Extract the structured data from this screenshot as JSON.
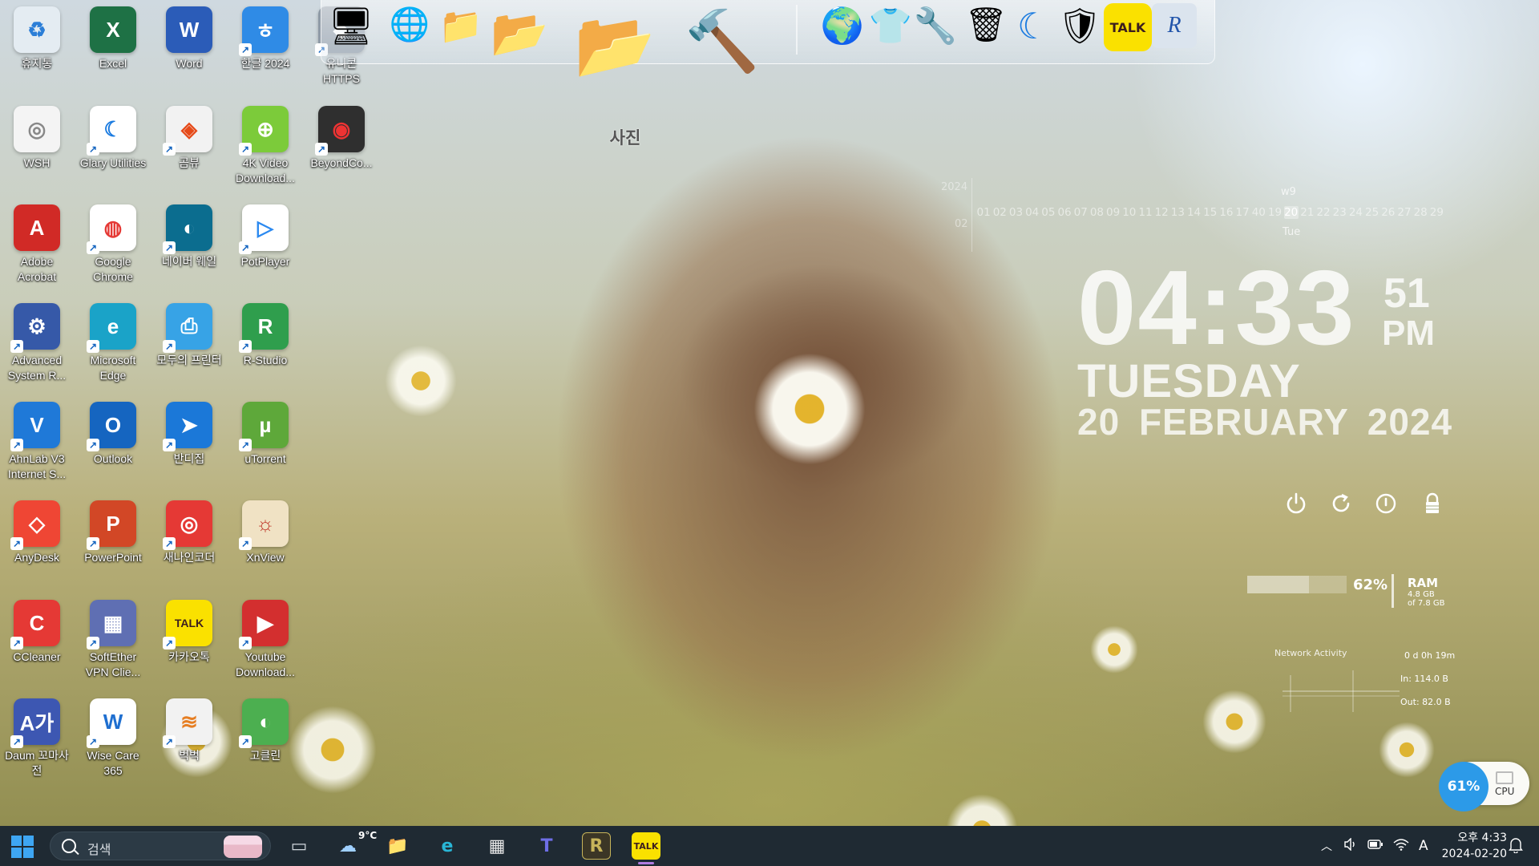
{
  "desktop": {
    "icons": [
      {
        "label": "휴지통",
        "color": "#e4ecf2",
        "fg": "#2b7ed7",
        "glyph": "♻",
        "shortcut": false
      },
      {
        "label": "Excel",
        "color": "#1e7145",
        "fg": "#fff",
        "glyph": "X",
        "shortcut": false
      },
      {
        "label": "Word",
        "color": "#2b5cb8",
        "fg": "#fff",
        "glyph": "W",
        "shortcut": false
      },
      {
        "label": "한글 2024",
        "color": "#2f8be6",
        "fg": "#fff",
        "glyph": "ㅎ",
        "shortcut": true
      },
      {
        "label": "유니콘 HTTPS",
        "color": "#8f9aa6",
        "fg": "#fff",
        "glyph": "◆",
        "shortcut": true
      },
      {
        "label": "WSH",
        "color": "#f4f4f4",
        "fg": "#888",
        "glyph": "◎",
        "shortcut": false
      },
      {
        "label": "Glary Utilities",
        "color": "#ffffff",
        "fg": "#1b7be0",
        "glyph": "☾",
        "shortcut": true
      },
      {
        "label": "곰뷰",
        "color": "#f2f2f2",
        "fg": "#e64a19",
        "glyph": "◈",
        "shortcut": true
      },
      {
        "label": "4K Video Download...",
        "color": "#7ccb3a",
        "fg": "#fff",
        "glyph": "⊕",
        "shortcut": true
      },
      {
        "label": "BeyondCo...",
        "color": "#2f2f2f",
        "fg": "#e33",
        "glyph": "◉",
        "shortcut": true
      },
      {
        "label": "Adobe Acrobat",
        "color": "#d12a26",
        "fg": "#fff",
        "glyph": "A",
        "shortcut": false
      },
      {
        "label": "Google Chrome",
        "color": "#ffffff",
        "fg": "#e53935",
        "glyph": "◍",
        "shortcut": true
      },
      {
        "label": "네이버 웨일",
        "color": "#0b6d8f",
        "fg": "#fff",
        "glyph": "◐",
        "shortcut": true
      },
      {
        "label": "PotPlayer",
        "color": "#ffffff",
        "fg": "#2b89f0",
        "glyph": "▷",
        "shortcut": true
      },
      {
        "label": "Advanced System R...",
        "color": "#3659a8",
        "fg": "#fff",
        "glyph": "⚙",
        "shortcut": true
      },
      {
        "label": "Microsoft Edge",
        "color": "#1aa3c8",
        "fg": "#fff",
        "glyph": "e",
        "shortcut": true
      },
      {
        "label": "모두의 프린터",
        "color": "#37a3e6",
        "fg": "#fff",
        "glyph": "⎙",
        "shortcut": true
      },
      {
        "label": "R-Studio",
        "color": "#2f9e4d",
        "fg": "#fff",
        "glyph": "R",
        "shortcut": true
      },
      {
        "label": "AhnLab V3 Internet S...",
        "color": "#1f79d8",
        "fg": "#fff",
        "glyph": "V",
        "shortcut": true
      },
      {
        "label": "Outlook",
        "color": "#1565c0",
        "fg": "#fff",
        "glyph": "O",
        "shortcut": true
      },
      {
        "label": "반디집",
        "color": "#1b78d8",
        "fg": "#fff",
        "glyph": "➤",
        "shortcut": true
      },
      {
        "label": "uTorrent",
        "color": "#5ea83a",
        "fg": "#fff",
        "glyph": "µ",
        "shortcut": true
      },
      {
        "label": "AnyDesk",
        "color": "#ef4634",
        "fg": "#fff",
        "glyph": "◇",
        "shortcut": true
      },
      {
        "label": "PowerPoint",
        "color": "#d24726",
        "fg": "#fff",
        "glyph": "P",
        "shortcut": true
      },
      {
        "label": "새나인코더",
        "color": "#e53935",
        "fg": "#fff",
        "glyph": "◎",
        "shortcut": true
      },
      {
        "label": "XnView",
        "color": "#f0e2c4",
        "fg": "#c0392b",
        "glyph": "☼",
        "shortcut": true
      },
      {
        "label": "CCleaner",
        "color": "#e53935",
        "fg": "#fff",
        "glyph": "C",
        "shortcut": true
      },
      {
        "label": "SoftEther VPN Clie...",
        "color": "#5f6fb3",
        "fg": "#fff",
        "glyph": "▦",
        "shortcut": true
      },
      {
        "label": "카카오톡",
        "color": "#fae100",
        "fg": "#3c1e1e",
        "glyph": "TALK",
        "shortcut": true
      },
      {
        "label": "Youtube Download...",
        "color": "#d32f2f",
        "fg": "#fff",
        "glyph": "▶",
        "shortcut": true
      },
      {
        "label": "Daum 꼬마사전",
        "color": "#3d57b2",
        "fg": "#fff",
        "glyph": "A가",
        "shortcut": true
      },
      {
        "label": "Wise Care 365",
        "color": "#ffffff",
        "fg": "#1f6fd0",
        "glyph": "W",
        "shortcut": true
      },
      {
        "label": "벅벅",
        "color": "#f2f2f2",
        "fg": "#e67e22",
        "glyph": "≋",
        "shortcut": true
      },
      {
        "label": "고클린",
        "color": "#4caf50",
        "fg": "#fff",
        "glyph": "◐",
        "shortcut": true
      }
    ]
  },
  "dock": {
    "items": [
      {
        "name": "network-computer-icon",
        "glyph": "🖥",
        "size": 58
      },
      {
        "name": "globe-computer-icon",
        "glyph": "🌐",
        "size": 52
      },
      {
        "name": "documents-folder-icon",
        "glyph": "📁",
        "size": 56
      },
      {
        "name": "music-folder-icon",
        "glyph": "📂",
        "size": 74
      },
      {
        "name": "photos-folder-icon",
        "glyph": "📂",
        "size": 104
      },
      {
        "name": "tools-icon",
        "glyph": "🔨",
        "size": 96
      },
      {
        "name": "internet-globe-icon",
        "glyph": "🌍",
        "size": 56
      },
      {
        "name": "tshirt-icon",
        "glyph": "👕",
        "size": 56
      },
      {
        "name": "system-tools-icon",
        "glyph": "🔧",
        "size": 56
      },
      {
        "name": "recycle-bin-icon",
        "glyph": "🗑",
        "size": 54
      },
      {
        "name": "glary-icon",
        "glyph": "☾",
        "size": 56
      },
      {
        "name": "wise-care-icon",
        "glyph": "🛡",
        "size": 56
      },
      {
        "name": "kakaotalk-icon",
        "glyph": "TALK",
        "size": 60
      },
      {
        "name": "r-studio-icon",
        "glyph": "R",
        "size": 56
      }
    ],
    "hover_label": "사진"
  },
  "calendar": {
    "year": "2024",
    "month": "02",
    "week": "w9",
    "days": [
      "01",
      "02",
      "03",
      "04",
      "05",
      "06",
      "07",
      "08",
      "09",
      "10",
      "11",
      "12",
      "13",
      "14",
      "15",
      "16",
      "17",
      "40",
      "19",
      "20",
      "21",
      "22",
      "23",
      "24",
      "25",
      "26",
      "27",
      "28",
      "29"
    ],
    "today_index": 19,
    "today_dow": "Tue"
  },
  "clock": {
    "time": "04:33",
    "seconds": "51",
    "ampm": "PM",
    "day": "TUESDAY",
    "date": "20 FEBRUARY  2024"
  },
  "power_buttons": [
    "power-icon",
    "restart-icon",
    "sleep-icon",
    "lock-icon"
  ],
  "ram": {
    "percent_text": "62%",
    "percent": 62,
    "label": "RAM",
    "used": "4.8 GB",
    "total": "of 7.8 GB"
  },
  "network": {
    "title": "Network Activity",
    "uptime": "0 d 0h 19m",
    "in": "In: 114.0 B",
    "out": "Out: 82.0 B"
  },
  "cpu_widget": {
    "percent_text": "61%",
    "label": "CPU"
  },
  "taskbar": {
    "search_placeholder": "검색",
    "weather": "9°C",
    "apps": [
      {
        "name": "task-view-icon",
        "glyph": "▭",
        "color": "#cfd6dc"
      },
      {
        "name": "weather-icon",
        "glyph": "☁",
        "color": "#9fd0ff"
      },
      {
        "name": "file-explorer-icon",
        "glyph": "📁",
        "color": "#f2c23b"
      },
      {
        "name": "edge-icon",
        "glyph": "e",
        "color": "#29b6d6"
      },
      {
        "name": "store-icon",
        "glyph": "▦",
        "color": "#e8e8e8"
      },
      {
        "name": "teams-icon",
        "glyph": "T",
        "color": "#6e6ee6"
      },
      {
        "name": "r-app-icon",
        "glyph": "R",
        "color": "#c7b45a"
      },
      {
        "name": "kakaotalk-taskbar-icon",
        "glyph": "TALK",
        "color": "#fae100"
      }
    ],
    "ime": "A",
    "time": "오후 4:33",
    "date": "2024-02-20"
  }
}
